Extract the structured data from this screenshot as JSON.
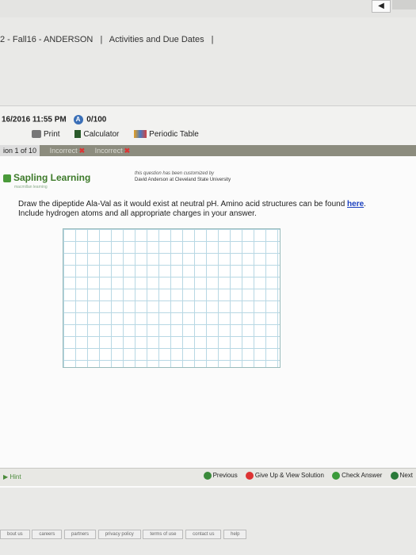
{
  "course_bar": {
    "course": "2 - Fall16 - ANDERSON",
    "sep1": "|",
    "activities": "Activities and Due Dates",
    "sep2": "|"
  },
  "header": {
    "due": "16/2016 11:55 PM",
    "score": "0/100"
  },
  "toolbar": {
    "print": "Print",
    "calculator": "Calculator",
    "periodic_table": "Periodic Table"
  },
  "question_nav": {
    "question_label": "ion 1 of 10",
    "attempts": [
      "Incorrect",
      "Incorrect"
    ]
  },
  "logo": {
    "name": "Sapling Learning",
    "tagline": "macmillan learning"
  },
  "customized": {
    "line1": "this question has been customized by",
    "line2": "David Anderson at Cleveland State University"
  },
  "prompt": {
    "line1": "Draw the dipeptide Ala-Val as it would exist at neutral pH. Amino acid structures can be found",
    "link": "here",
    "line2": "Include hydrogen atoms and all appropriate charges in your answer."
  },
  "bottom": {
    "hint": "Hint",
    "previous": "Previous",
    "give_up": "Give Up & View Solution",
    "check": "Check Answer",
    "next": "Next"
  },
  "footer": {
    "links": [
      "bout us",
      "careers",
      "partners",
      "privacy policy",
      "terms of use",
      "contact us",
      "help"
    ]
  },
  "colors": {
    "accent_green": "#4a9a3a",
    "link_blue": "#1a3fbf",
    "incorrect_red": "#d33"
  }
}
